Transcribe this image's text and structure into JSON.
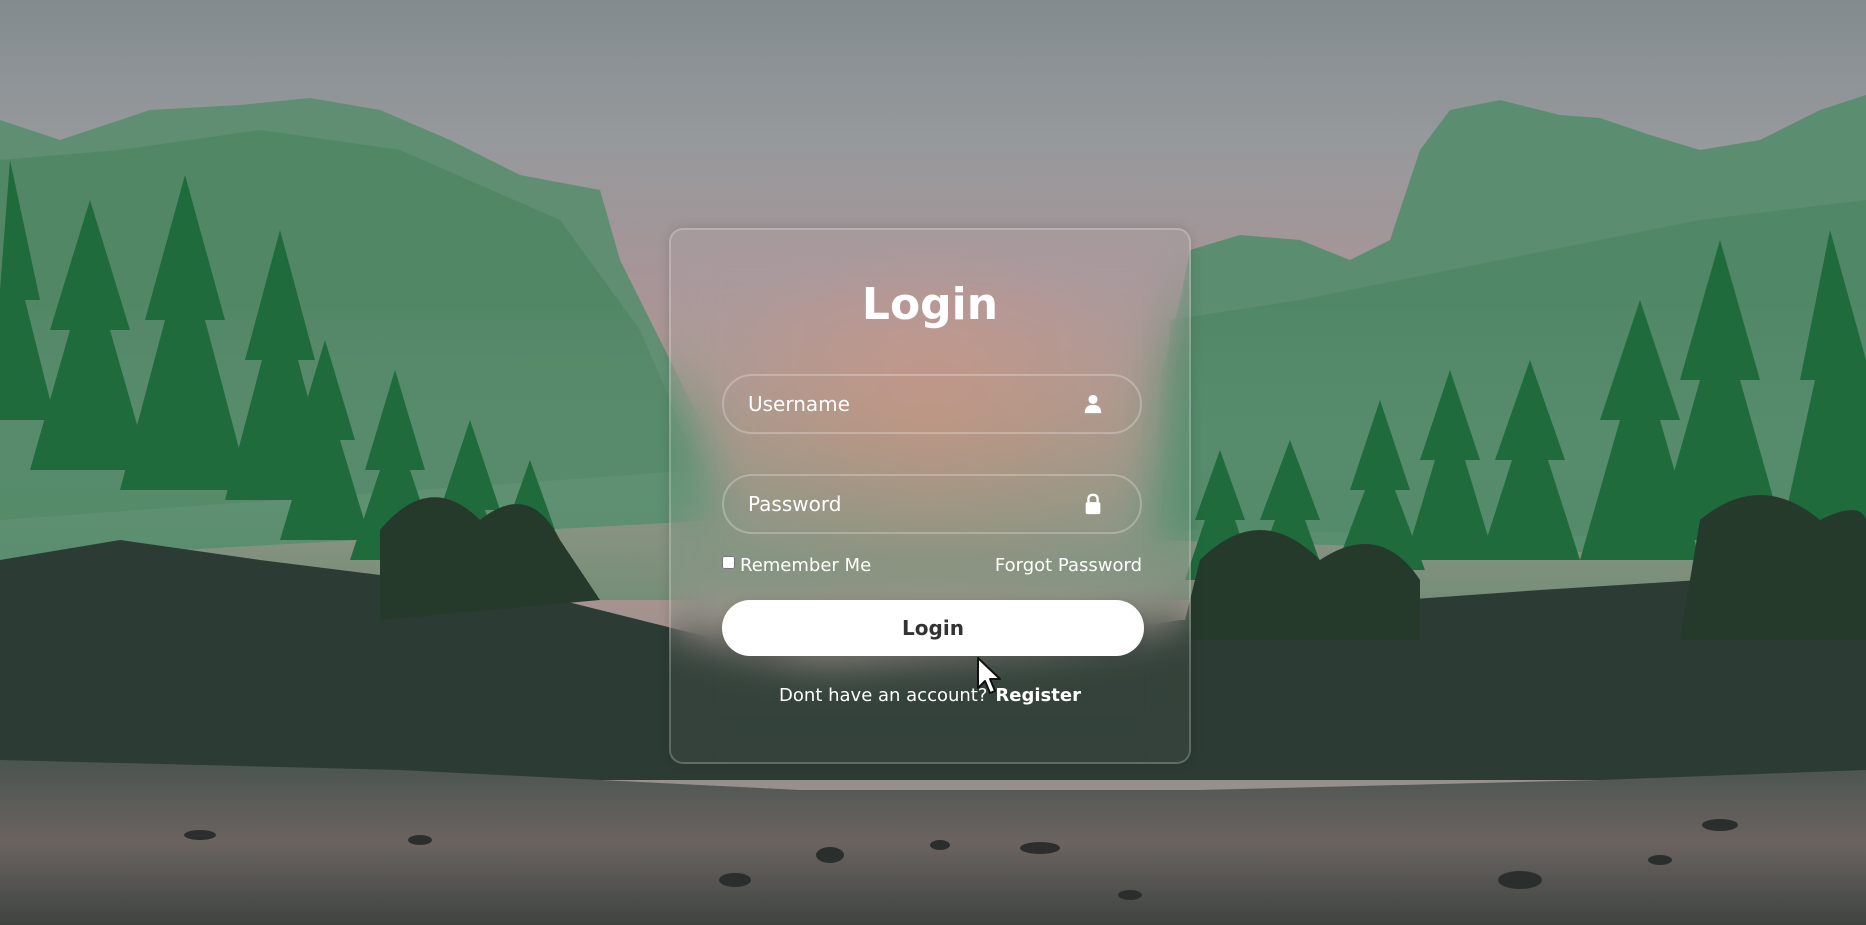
{
  "login_form": {
    "title": "Login",
    "username": {
      "placeholder": "Username",
      "value": "",
      "icon": "user-icon"
    },
    "password": {
      "placeholder": "Password",
      "value": "",
      "icon": "lock-icon"
    },
    "remember_label": "Remember Me",
    "remember_checked": false,
    "forgot_label": "Forgot Password",
    "submit_label": "Login",
    "register_prompt": "Dont have an account?",
    "register_label": "Register"
  },
  "colors": {
    "text": "#ffffff",
    "button_bg": "#ffffff",
    "button_text": "#333333",
    "border": "rgba(255,255,255,0.25)"
  }
}
